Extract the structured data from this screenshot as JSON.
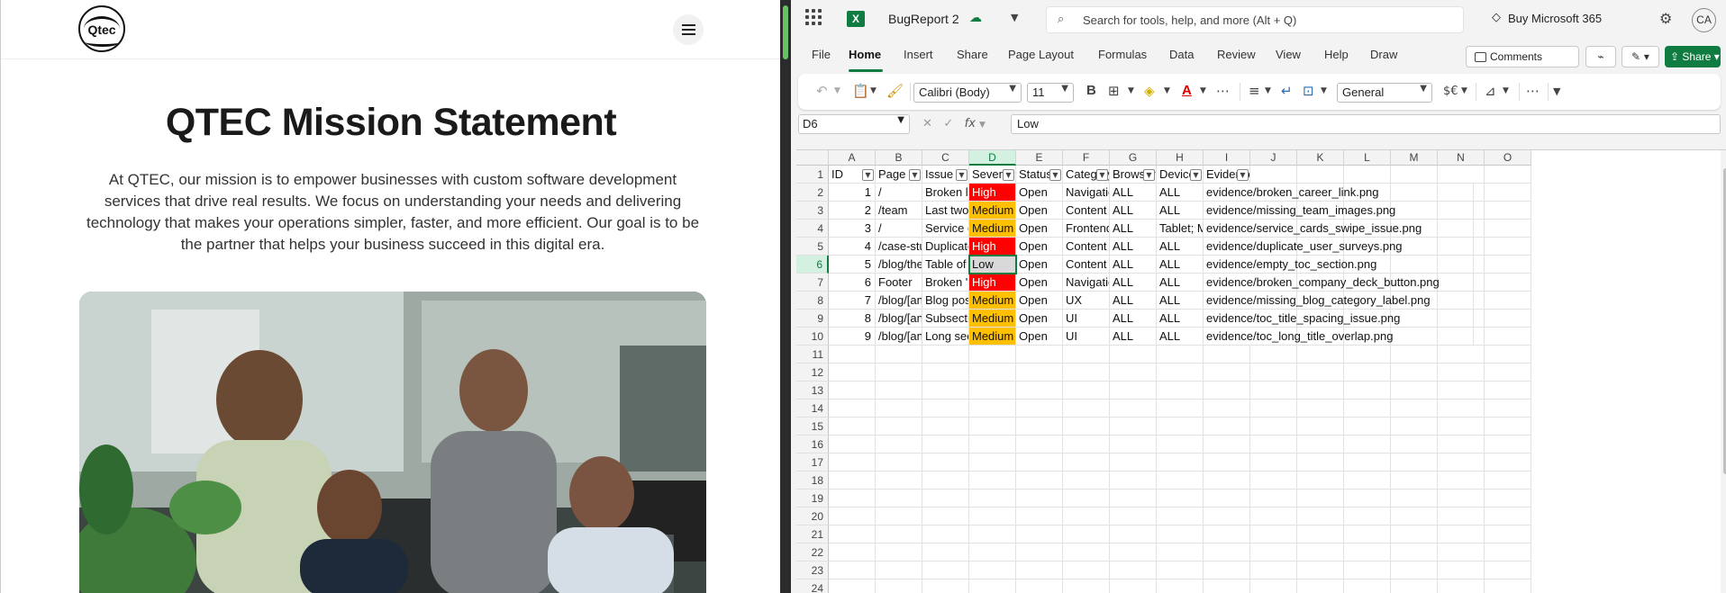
{
  "website": {
    "logo_text": "Qtec",
    "title": "QTEC Mission Statement",
    "mission_text": "At QTEC, our mission is to empower businesses with custom software development services that drive real results. We focus on understanding your needs and delivering technology that makes your operations simpler, faster, and more efficient. Our goal is to be the partner that helps your business succeed in this digital era."
  },
  "excel": {
    "app_icon": "X",
    "document_name": "BugReport 2",
    "search_placeholder": "Search for tools, help, and more (Alt + Q)",
    "buy_label": "Buy Microsoft 365",
    "avatar_initials": "CA",
    "menu_tabs": [
      "File",
      "Home",
      "Insert",
      "Share",
      "Page Layout",
      "Formulas",
      "Data",
      "Review",
      "View",
      "Help",
      "Draw"
    ],
    "active_tab": "Home",
    "comments_label": "Comments",
    "share_label": "Share",
    "font_name": "Calibri (Body)",
    "font_size": "11",
    "number_format": "General",
    "currency_symbol": "$€",
    "name_box": "D6",
    "formula_value": "Low",
    "columns": [
      "A",
      "B",
      "C",
      "D",
      "E",
      "F",
      "G",
      "H",
      "I",
      "J",
      "K",
      "L",
      "M",
      "N",
      "O"
    ],
    "selected_column": "D",
    "selected_row": 6,
    "row_numbers": [
      1,
      2,
      3,
      4,
      5,
      6,
      7,
      8,
      9,
      10,
      11,
      12,
      13,
      14,
      15,
      16,
      17,
      18,
      19,
      20,
      21,
      22,
      23,
      24
    ],
    "headers": [
      "ID",
      "Page",
      "Issue",
      "Severity",
      "Status",
      "Category",
      "Browser",
      "Device",
      "Evidence"
    ],
    "rows": [
      {
        "id": "1",
        "page": "/",
        "issue": "Broken link",
        "severity": "High",
        "status": "Open",
        "category": "Navigation",
        "browser": "ALL",
        "device": "ALL",
        "evidence": "evidence/broken_career_link.png"
      },
      {
        "id": "2",
        "page": "/team",
        "issue": "Last two m",
        "severity": "Medium",
        "status": "Open",
        "category": "Content",
        "browser": "ALL",
        "device": "ALL",
        "evidence": "evidence/missing_team_images.png"
      },
      {
        "id": "3",
        "page": "/",
        "issue": "Service ca",
        "severity": "Medium",
        "status": "Open",
        "category": "Frontend",
        "browser": "ALL",
        "device": "Tablet; Mo",
        "evidence": "evidence/service_cards_swipe_issue.png"
      },
      {
        "id": "4",
        "page": "/case-stud",
        "issue": "Duplicate",
        "severity": "High",
        "status": "Open",
        "category": "Content",
        "browser": "ALL",
        "device": "ALL",
        "evidence": "evidence/duplicate_user_surveys.png"
      },
      {
        "id": "5",
        "page": "/blog/the-",
        "issue": "Table of co",
        "severity": "Low",
        "status": "Open",
        "category": "Content",
        "browser": "ALL",
        "device": "ALL",
        "evidence": "evidence/empty_toc_section.png"
      },
      {
        "id": "6",
        "page": "Footer",
        "issue": "Broken 'Co",
        "severity": "High",
        "status": "Open",
        "category": "Navigation",
        "browser": "ALL",
        "device": "ALL",
        "evidence": "evidence/broken_company_deck_button.png"
      },
      {
        "id": "7",
        "page": "/blog/[any",
        "issue": "Blog post c",
        "severity": "Medium",
        "status": "Open",
        "category": "UX",
        "browser": "ALL",
        "device": "ALL",
        "evidence": "evidence/missing_blog_category_label.png"
      },
      {
        "id": "8",
        "page": "/blog/[any",
        "issue": "Subsection",
        "severity": "Medium",
        "status": "Open",
        "category": "UI",
        "browser": "ALL",
        "device": "ALL",
        "evidence": "evidence/toc_title_spacing_issue.png"
      },
      {
        "id": "9",
        "page": "/blog/[any",
        "issue": "Long sectio",
        "severity": "Medium",
        "status": "Open",
        "category": "UI",
        "browser": "ALL",
        "device": "ALL",
        "evidence": "evidence/toc_long_title_overlap.png"
      }
    ],
    "colors": {
      "high": "#ff0000",
      "medium": "#ffc000",
      "low": "#d9d9d9",
      "accent": "#107c41"
    }
  }
}
